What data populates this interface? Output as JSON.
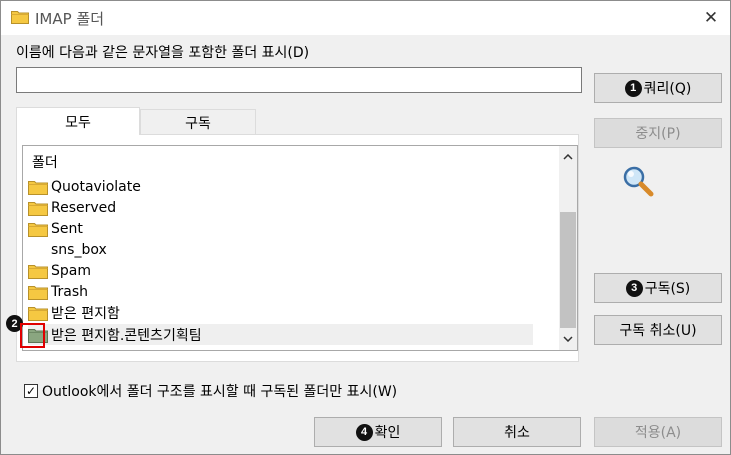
{
  "window": {
    "title": "IMAP 폴더",
    "close_glyph": "✕"
  },
  "filter": {
    "label": "이름에 다음과 같은 문자열을 포함한 폴더 표시(D)",
    "value": ""
  },
  "buttons": {
    "query": {
      "badge": "1",
      "label": "쿼리(Q)"
    },
    "stop": {
      "label": "중지(P)"
    },
    "subscribe": {
      "badge": "3",
      "label": "구독(S)"
    },
    "unsubscribe": {
      "label": "구독 취소(U)"
    },
    "ok": {
      "badge": "4",
      "label": "확인"
    },
    "cancel": {
      "label": "취소"
    },
    "apply": {
      "label": "적용(A)"
    }
  },
  "tabs": [
    {
      "label": "모두",
      "active": true
    },
    {
      "label": "구독",
      "active": false
    }
  ],
  "folder_list": {
    "header": "폴더",
    "items": [
      {
        "label": "Quotaviolate",
        "icon": "folder-icon"
      },
      {
        "label": "Reserved",
        "icon": "folder-icon"
      },
      {
        "label": "Sent",
        "icon": "folder-icon"
      },
      {
        "label": "sns_box",
        "icon": ""
      },
      {
        "label": "Spam",
        "icon": "folder-icon"
      },
      {
        "label": "Trash",
        "icon": "folder-icon"
      },
      {
        "label": "받은 편지함",
        "icon": "folder-icon"
      },
      {
        "label": "받은 편지함.콘텐츠기획팀",
        "icon": "subscribed-folder-icon"
      }
    ]
  },
  "markers": {
    "selected_item_badge": "2"
  },
  "checkbox": {
    "label": "Outlook에서 폴더 구조를 표시할 때 구독된 폴더만 표시(W)",
    "checked": true,
    "check_glyph": "✓"
  },
  "icons": {
    "title": "folder-icon",
    "side": "magnifier-icon"
  },
  "colors": {
    "folder": "#f5c842",
    "subscribed_folder": "#8aa680",
    "marker": "#e00000"
  }
}
